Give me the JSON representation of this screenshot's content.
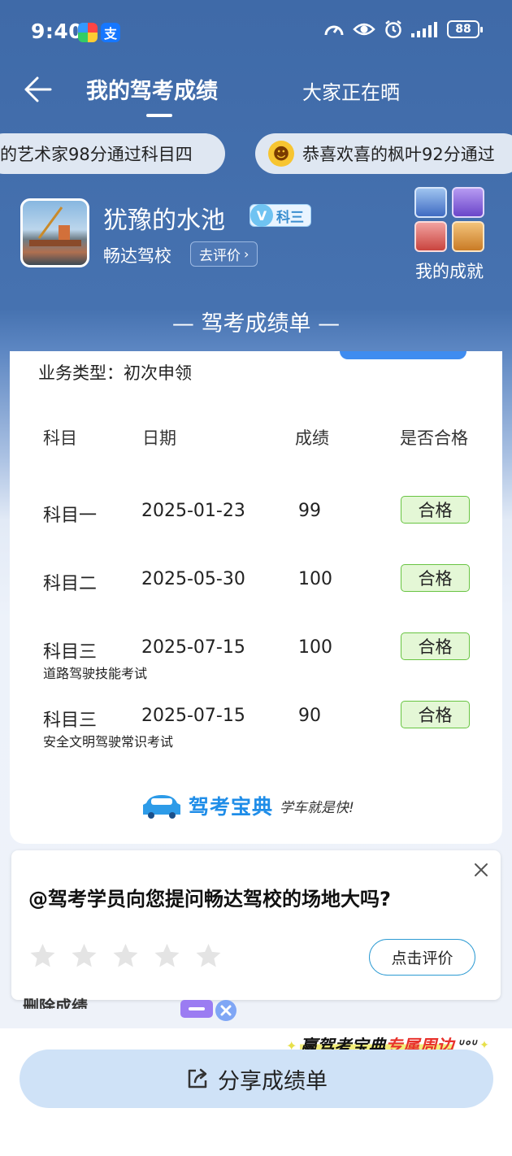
{
  "status_bar": {
    "time": "9:40",
    "battery": "88"
  },
  "nav": {
    "title": "我的驾考成绩",
    "tab2": "大家正在晒"
  },
  "ticker": [
    "的艺术家98分通过科目四",
    "恭喜欢喜的枫叶92分通过"
  ],
  "profile": {
    "username": "犹豫的水池",
    "badge": "科三",
    "school": "畅达驾校",
    "rate_label": "去评价",
    "achievement_label": "我的成就"
  },
  "section_title": "— 驾考成绩单 —",
  "card": {
    "business_type": "业务类型：初次申领",
    "headers": [
      "科目",
      "日期",
      "成绩",
      "是否合格"
    ],
    "rows": [
      {
        "subject": "科目一",
        "date": "2025-01-23",
        "score": "99",
        "status": "合格",
        "note": ""
      },
      {
        "subject": "科目二",
        "date": "2025-05-30",
        "score": "100",
        "status": "合格",
        "note": ""
      },
      {
        "subject": "科目三",
        "date": "2025-07-15",
        "score": "100",
        "status": "合格",
        "note": "道路驾驶技能考试"
      },
      {
        "subject": "科目三",
        "date": "2025-07-15",
        "score": "90",
        "status": "合格",
        "note": "安全文明驾驶常识考试"
      }
    ],
    "brand_name": "驾考宝典",
    "brand_slogan": "学车就是快!"
  },
  "question": {
    "text": "@驾考学员向您提问畅达驾校的场地大吗?",
    "star_count": 5,
    "button": "点击评价"
  },
  "peek_text": "删除成绩",
  "promo": {
    "part1": "赢驾考宝典",
    "part2": "专属周边"
  },
  "share_label": "分享成绩单",
  "colors": {
    "header_blue": "#3f6aa8",
    "pass_green": "#68c442",
    "brand_blue": "#1f8de8",
    "promo_red": "#e8322c"
  }
}
